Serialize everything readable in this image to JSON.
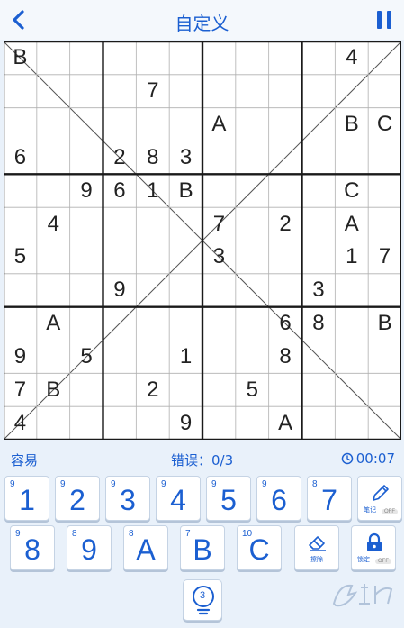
{
  "header": {
    "title": "自定义",
    "back_icon": "chevron-left-icon",
    "pause_icon": "pause-icon",
    "accent_color": "#1b5fd1"
  },
  "board": {
    "cells": [
      [
        "B",
        "",
        "",
        "",
        "",
        "",
        "",
        "",
        "",
        "",
        "4",
        ""
      ],
      [
        "",
        "",
        "",
        "",
        "7",
        "",
        "",
        "",
        "",
        "",
        "",
        ""
      ],
      [
        "",
        "",
        "",
        "",
        "",
        "",
        "A",
        "",
        "",
        "",
        "B",
        "C"
      ],
      [
        "6",
        "",
        "",
        "2",
        "8",
        "3",
        "",
        "",
        "",
        "",
        "",
        ""
      ],
      [
        "",
        "",
        "9",
        "6",
        "1",
        "B",
        "",
        "",
        "",
        "",
        "C",
        ""
      ],
      [
        "",
        "4",
        "",
        "",
        "",
        "",
        "7",
        "",
        "2",
        "",
        "A",
        ""
      ],
      [
        "5",
        "",
        "",
        "",
        "",
        "",
        "3",
        "",
        "",
        "",
        "1",
        "7"
      ],
      [
        "",
        "",
        "",
        "9",
        "",
        "",
        "",
        "",
        "",
        "3",
        "",
        ""
      ],
      [
        "",
        "A",
        "",
        "",
        "",
        "",
        "",
        "",
        "6",
        "8",
        "",
        "B"
      ],
      [
        "9",
        "",
        "5",
        "",
        "",
        "1",
        "",
        "",
        "8",
        "",
        "",
        ""
      ],
      [
        "7",
        "B",
        "",
        "",
        "2",
        "",
        "",
        "5",
        "",
        "",
        "",
        ""
      ],
      [
        "4",
        "",
        "",
        "",
        "",
        "9",
        "",
        "",
        "A",
        "",
        "",
        ""
      ]
    ]
  },
  "status": {
    "difficulty": "容易",
    "errors": "错误：0/3",
    "timer": "00:07",
    "clock_icon": "clock-icon"
  },
  "keypad": {
    "keys": [
      {
        "label": "1",
        "count": "9"
      },
      {
        "label": "2",
        "count": "9"
      },
      {
        "label": "3",
        "count": "9"
      },
      {
        "label": "4",
        "count": "9"
      },
      {
        "label": "5",
        "count": "9"
      },
      {
        "label": "6",
        "count": "9"
      },
      {
        "label": "7",
        "count": "8"
      },
      {
        "label": "8",
        "count": "9"
      },
      {
        "label": "9",
        "count": "8"
      },
      {
        "label": "A",
        "count": "8"
      },
      {
        "label": "B",
        "count": "7"
      },
      {
        "label": "C",
        "count": "10"
      }
    ],
    "notes": {
      "label": "笔记",
      "state": "OFF",
      "icon": "pencil-icon"
    },
    "erase": {
      "label": "擦除",
      "icon": "eraser-icon"
    },
    "lock": {
      "label": "锁定",
      "state": "OFF",
      "icon": "lock-icon"
    }
  },
  "hint": {
    "count": "3",
    "icon": "lightbulb-icon"
  }
}
